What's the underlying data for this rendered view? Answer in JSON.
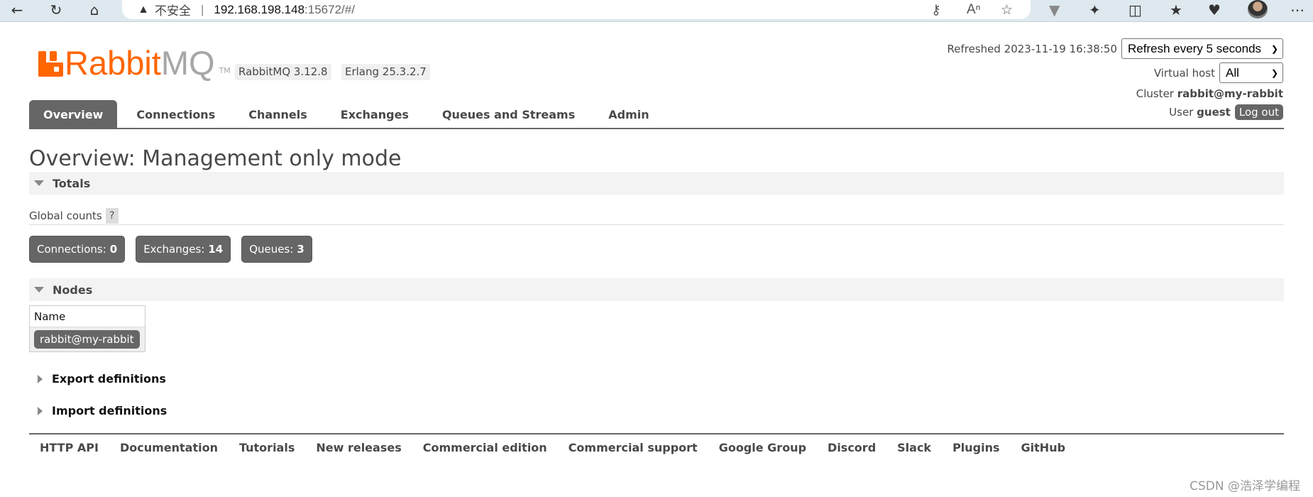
{
  "browser": {
    "insecure_label": "不安全",
    "url_host": "192.168.198.148",
    "url_path": ":15672/#/",
    "icons": [
      "back-icon",
      "refresh-icon",
      "home-icon",
      "warning-icon",
      "key-icon",
      "read-aloud-icon",
      "star-icon",
      "vivaldi-icon",
      "extensions-icon",
      "split-screen-icon",
      "favorites-icon",
      "performance-icon",
      "profile-avatar",
      "more-icon"
    ]
  },
  "app": {
    "logo_brand": "Rabbit",
    "logo_mq": "MQ",
    "logo_tm": "TM",
    "version": "RabbitMQ 3.12.8",
    "erlang": "Erlang 25.3.2.7"
  },
  "header": {
    "refreshed_label": "Refreshed 2023-11-19 16:38:50",
    "refresh_select": "Refresh every 5 seconds",
    "vhost_label": "Virtual host",
    "vhost_select": "All",
    "cluster_label": "Cluster",
    "cluster_name": "rabbit@my-rabbit",
    "user_label": "User",
    "user_name": "guest",
    "logout_label": "Log out"
  },
  "tabs": [
    {
      "label": "Overview",
      "active": true
    },
    {
      "label": "Connections"
    },
    {
      "label": "Channels"
    },
    {
      "label": "Exchanges"
    },
    {
      "label": "Queues and Streams"
    },
    {
      "label": "Admin"
    }
  ],
  "main": {
    "title": "Overview: Management only mode",
    "totals_header": "Totals",
    "global_counts_label": "Global counts",
    "help_label": "?",
    "counts": [
      {
        "label": "Connections:",
        "value": "0"
      },
      {
        "label": "Exchanges:",
        "value": "14"
      },
      {
        "label": "Queues:",
        "value": "3"
      }
    ],
    "nodes_header": "Nodes",
    "nodes_column": "Name",
    "node_name": "rabbit@my-rabbit",
    "export_label": "Export definitions",
    "import_label": "Import definitions"
  },
  "footer": {
    "links": [
      "HTTP API",
      "Documentation",
      "Tutorials",
      "New releases",
      "Commercial edition",
      "Commercial support",
      "Google Group",
      "Discord",
      "Slack",
      "Plugins",
      "GitHub"
    ]
  },
  "watermark": "CSDN @浩泽学编程",
  "colors": {
    "brand_orange": "#ff6600",
    "tab_active": "#666666",
    "browser_bar": "#dde9ee"
  }
}
